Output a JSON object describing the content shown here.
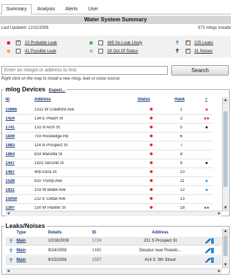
{
  "tabs": [
    {
      "label": "Summary",
      "active": true
    },
    {
      "label": "Analysis",
      "active": false
    },
    {
      "label": "Alerts",
      "active": false
    },
    {
      "label": "User",
      "active": false
    }
  ],
  "title": "Water System Summary",
  "last_updated": "Last Updated: 12/11/2008",
  "installed": "573 mlogs installe",
  "legend": [
    {
      "symbol": "dot",
      "color": "#e8202a",
      "checked": true,
      "label": "23 Probable Leak"
    },
    {
      "symbol": "dot",
      "color": "#f2b21d",
      "checked": false,
      "label": "41 Possible Leak"
    },
    {
      "symbol": "dot",
      "color": "#34c24a",
      "checked": false,
      "label": "485 No Leak Likely"
    },
    {
      "symbol": "dot",
      "color": "#bbbbbb",
      "checked": false,
      "label": "24 Out Of Status"
    },
    {
      "symbol": "pin",
      "color": "#2a8ad0",
      "checked": true,
      "label": "225 Leaks"
    },
    {
      "symbol": "pin",
      "color": "#111111",
      "checked": true,
      "label": "31 Noises"
    }
  ],
  "search": {
    "placeholder": "Enter an mlogid or address to find",
    "button_label": "Search",
    "hint": "Right click on the map to install a new mlog, leak or noise source"
  },
  "devices": {
    "title": "mlog Devices",
    "export_label": "Export...",
    "columns": [
      "ID",
      "Address",
      "Status",
      "Rank",
      "+"
    ],
    "rows": [
      {
        "id": "15866",
        "address": "1311 W Crawford Ave",
        "status": "red",
        "rank": "1",
        "tags": [
          "red"
        ]
      },
      {
        "id": "1424",
        "address": "134 E Peach St",
        "status": "red",
        "rank": "2",
        "tags": [
          "red",
          "red"
        ]
      },
      {
        "id": "1741",
        "address": "131 N Arch St",
        "status": "red",
        "rank": "5",
        "tags": [
          "black"
        ]
      },
      {
        "id": "1849",
        "address": "703 Rockledge Rd",
        "status": "red",
        "rank": "6",
        "tags": []
      },
      {
        "id": "1883",
        "address": "114 N Prospect St",
        "status": "red",
        "rank": "7",
        "tags": []
      },
      {
        "id": "1864",
        "address": "814 Marietta St",
        "status": "red",
        "rank": "8",
        "tags": []
      },
      {
        "id": "1447",
        "address": "1922 Second St",
        "status": "red",
        "rank": "9",
        "tags": [
          "black"
        ]
      },
      {
        "id": "1487",
        "address": "408 Eliza St",
        "status": "red",
        "rank": "10",
        "tags": []
      },
      {
        "id": "1528",
        "address": "610 Trump Ave",
        "status": "red",
        "rank": "11",
        "tags": [
          "blue"
        ]
      },
      {
        "id": "1621",
        "address": "103 W Blake Ave",
        "status": "red",
        "rank": "12",
        "tags": [
          "blue"
        ]
      },
      {
        "id": "15059",
        "address": "212 E Cedar Ave",
        "status": "red",
        "rank": "13",
        "tags": []
      },
      {
        "id": "1397",
        "address": "150 W Painter St",
        "status": "red",
        "rank": "18",
        "tags": [
          "blue",
          "blue"
        ]
      }
    ]
  },
  "leaks": {
    "title": "Leaks/Noises",
    "columns": [
      "Type",
      "Details",
      "ID",
      "Address"
    ],
    "rows": [
      {
        "type": "Main",
        "date": "10/18/2008",
        "id": "1724",
        "address": "231 S Prospect St"
      },
      {
        "type": "Main",
        "date": "9/24/2008",
        "id": "1465",
        "address": "Decatur near Pulaski..."
      },
      {
        "type": "Main",
        "date": "9/15/2008",
        "id": "1597",
        "address": "414 S. 9th Street"
      }
    ]
  },
  "colors": {
    "status_red": "#e23",
    "tag_blue": "#2a8ad0",
    "tag_black": "#111",
    "link": "#1a3a7a"
  }
}
